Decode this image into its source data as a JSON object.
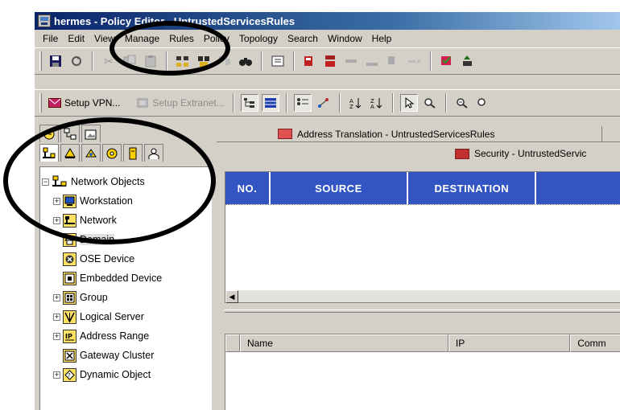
{
  "window": {
    "title": "hermes - Policy Editor - UntrustedServicesRules"
  },
  "menu": [
    {
      "label": "File"
    },
    {
      "label": "Edit"
    },
    {
      "label": "View"
    },
    {
      "label": "Manage"
    },
    {
      "label": "Rules"
    },
    {
      "label": "Policy"
    },
    {
      "label": "Topology"
    },
    {
      "label": "Search"
    },
    {
      "label": "Window"
    },
    {
      "label": "Help"
    }
  ],
  "toolbar2": {
    "setup_vpn": "Setup VPN...",
    "setup_extranet": "Setup Extranet..."
  },
  "left_tabs": {
    "row1": [
      "clock-icon",
      "rules-icon",
      "image-icon"
    ],
    "row2": [
      "network-objects-icon",
      "services-icon",
      "resources-icon",
      "servers-icon",
      "opsec-icon",
      "users-icon"
    ]
  },
  "tree": {
    "root": "Network Objects",
    "items": [
      {
        "label": "Workstation",
        "expandable": true,
        "icon": "workstation-icon"
      },
      {
        "label": "Network",
        "expandable": true,
        "icon": "network-icon"
      },
      {
        "label": "Domain",
        "expandable": false,
        "icon": "domain-icon",
        "selected": true
      },
      {
        "label": "OSE Device",
        "expandable": false,
        "icon": "ose-device-icon"
      },
      {
        "label": "Embedded Device",
        "expandable": false,
        "icon": "embedded-device-icon"
      },
      {
        "label": "Group",
        "expandable": true,
        "icon": "group-icon"
      },
      {
        "label": "Logical Server",
        "expandable": true,
        "icon": "logical-server-icon"
      },
      {
        "label": "Address Range",
        "expandable": true,
        "icon": "address-range-icon"
      },
      {
        "label": "Gateway Cluster",
        "expandable": false,
        "icon": "gateway-cluster-icon"
      },
      {
        "label": "Dynamic Object",
        "expandable": true,
        "icon": "dynamic-object-icon"
      }
    ]
  },
  "doc_tabs": {
    "address_translation": "Address Translation - UntrustedServicesRules",
    "security": "Security - UntrustedServic"
  },
  "rule_grid": {
    "columns": [
      "NO.",
      "SOURCE",
      "DESTINATION"
    ],
    "header_color": "#3355c4"
  },
  "object_list": {
    "columns": [
      "Name",
      "IP",
      "Comm"
    ]
  }
}
